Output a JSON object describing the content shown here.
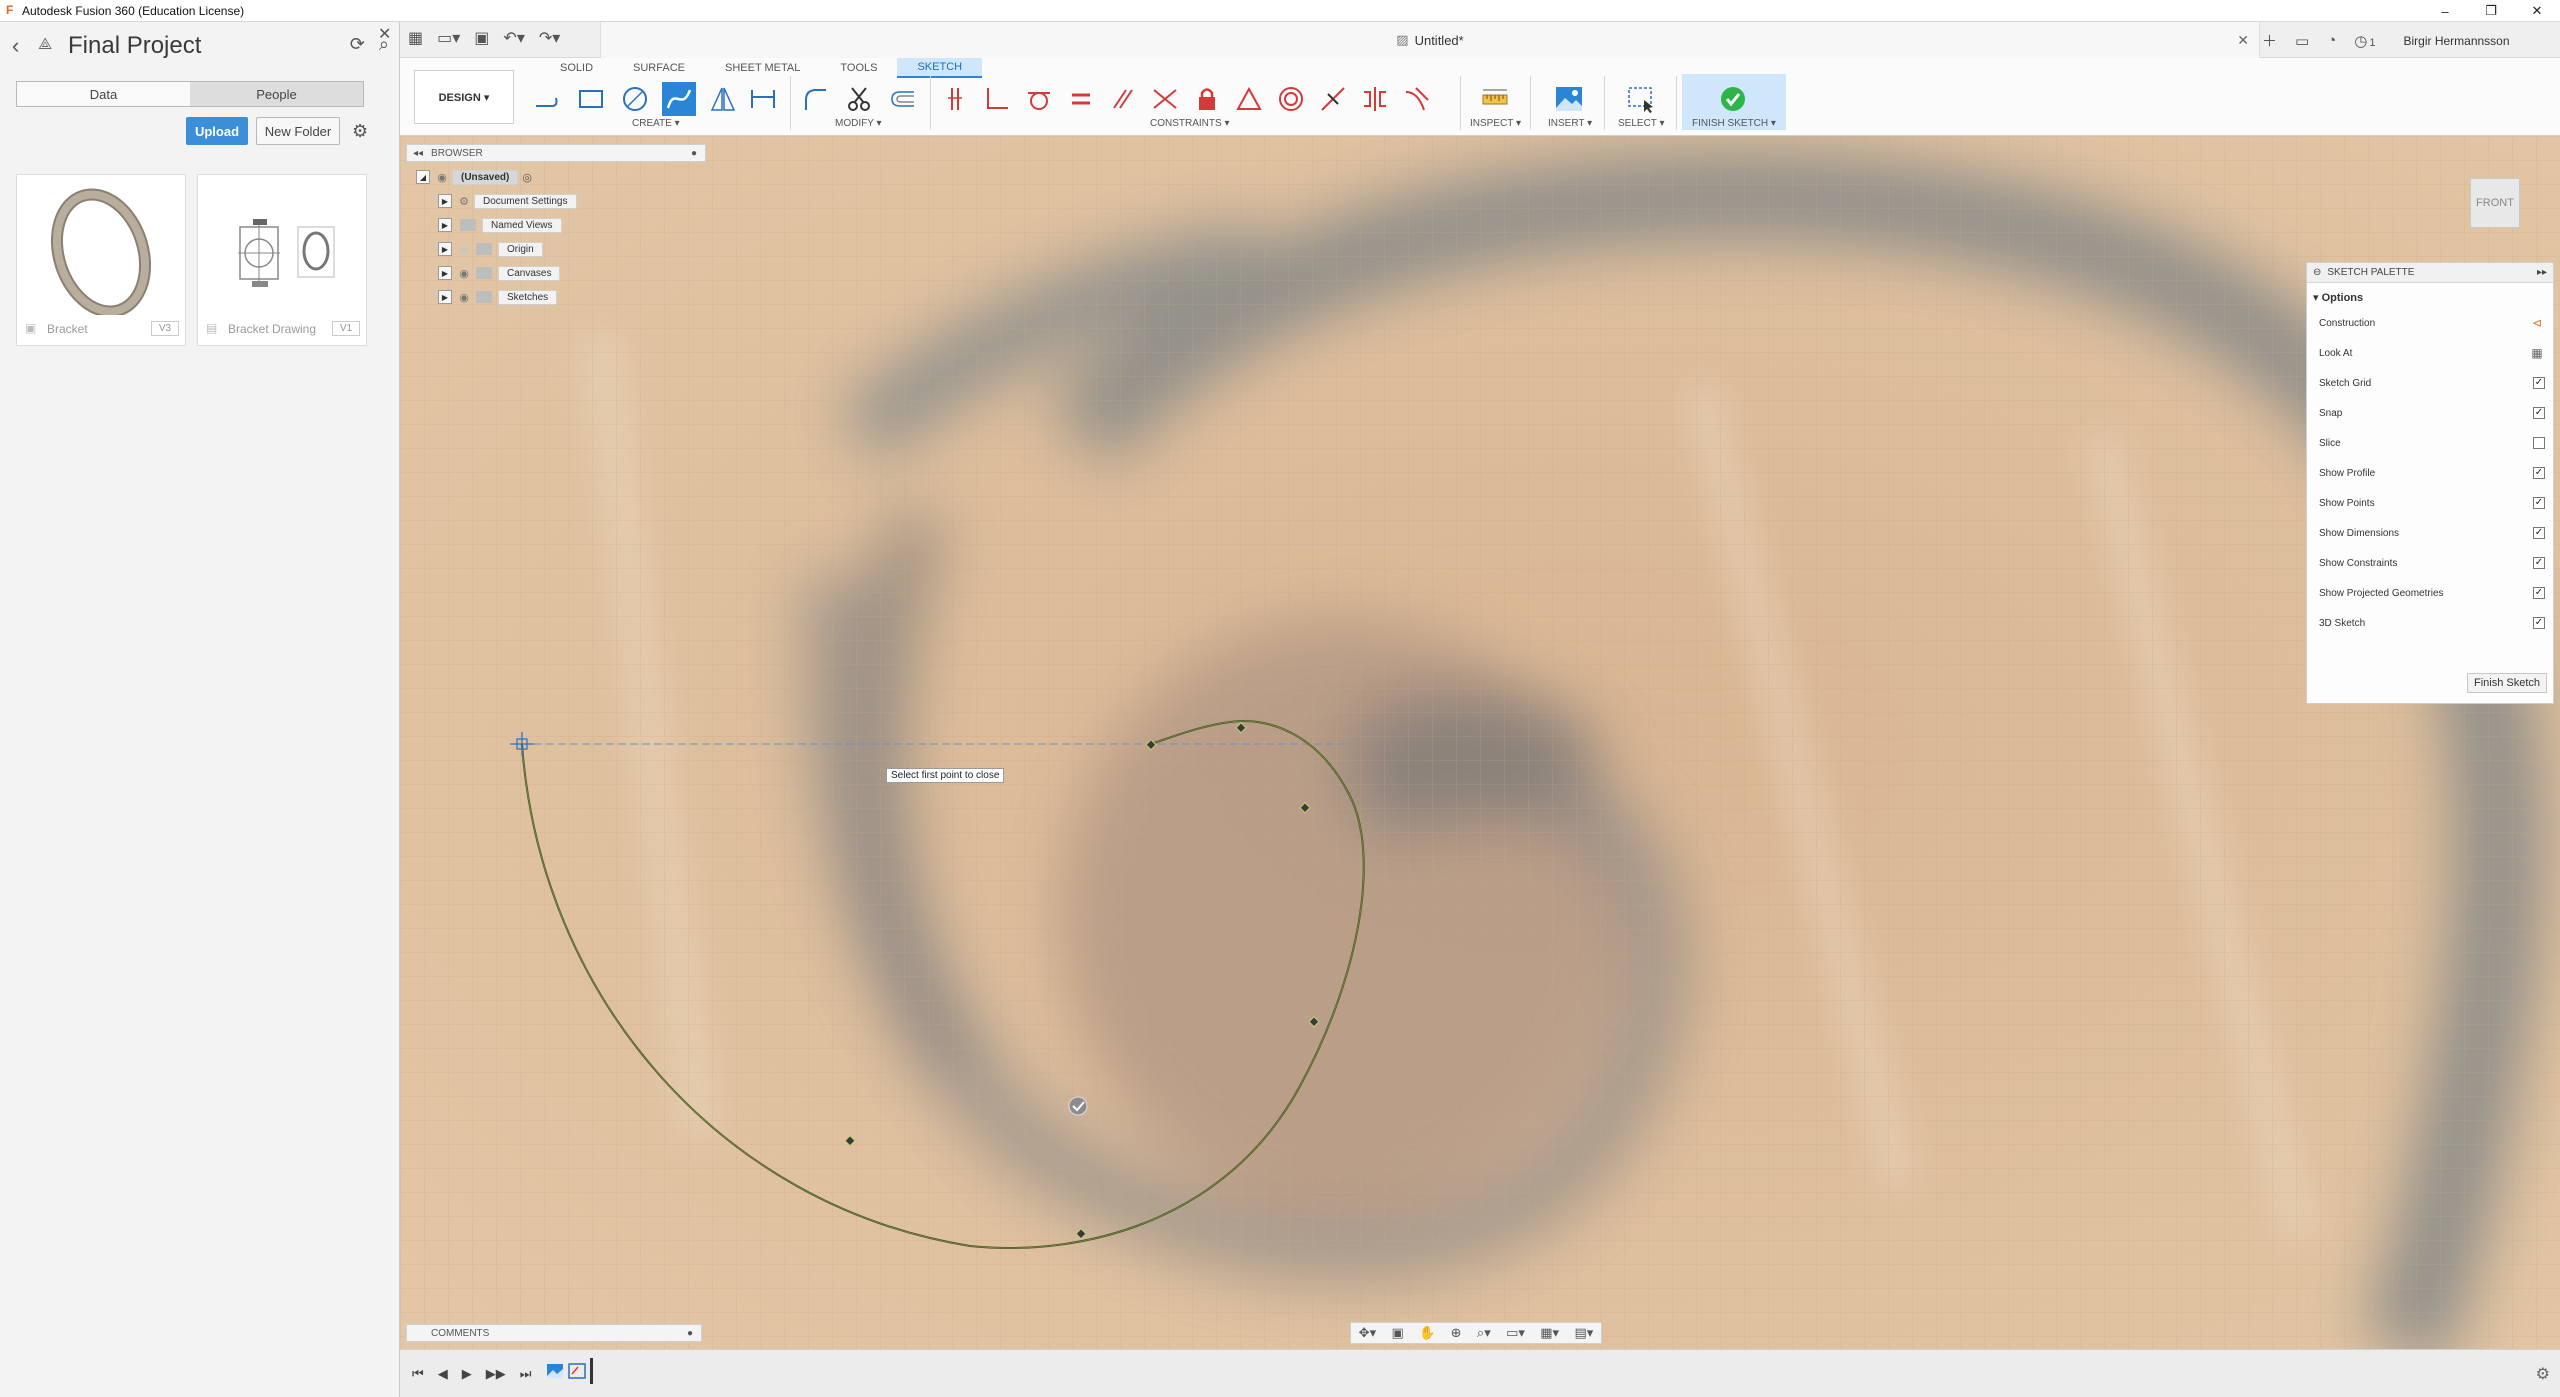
{
  "window": {
    "title": "Autodesk Fusion 360 (Education License)"
  },
  "data_panel": {
    "project_title": "Final Project",
    "tabs": [
      {
        "label": "Data"
      },
      {
        "label": "People"
      }
    ],
    "upload_label": "Upload",
    "new_folder_label": "New Folder",
    "files": [
      {
        "name": "Bracket",
        "version": "V3"
      },
      {
        "name": "Bracket Drawing",
        "version": "V1"
      }
    ]
  },
  "document": {
    "tab_title": "Untitled*",
    "user_name": "Birgir Hermannsson",
    "notification_count": "1"
  },
  "toolbar": {
    "tabs": [
      {
        "label": "SOLID"
      },
      {
        "label": "SURFACE"
      },
      {
        "label": "SHEET METAL"
      },
      {
        "label": "TOOLS"
      },
      {
        "label": "SKETCH",
        "active": true
      }
    ],
    "workspace_label": "DESIGN ▾",
    "groups": {
      "create": "CREATE ▾",
      "modify": "MODIFY ▾",
      "constraints": "CONSTRAINTS ▾",
      "inspect": "INSPECT ▾",
      "insert": "INSERT ▾",
      "select": "SELECT ▾",
      "finish_sketch": "FINISH SKETCH ▾"
    }
  },
  "browser": {
    "title": "BROWSER",
    "items": [
      {
        "label": "(Unsaved)"
      },
      {
        "label": "Document Settings"
      },
      {
        "label": "Named Views"
      },
      {
        "label": "Origin"
      },
      {
        "label": "Canvases"
      },
      {
        "label": "Sketches"
      }
    ]
  },
  "sketch_palette": {
    "title": "SKETCH PALETTE",
    "section": "Options",
    "options": [
      {
        "label": "Construction",
        "kind": "icon"
      },
      {
        "label": "Look At",
        "kind": "icon"
      },
      {
        "label": "Sketch Grid",
        "checked": true
      },
      {
        "label": "Snap",
        "checked": true
      },
      {
        "label": "Slice",
        "checked": false
      },
      {
        "label": "Show Profile",
        "checked": true
      },
      {
        "label": "Show Points",
        "checked": true
      },
      {
        "label": "Show Dimensions",
        "checked": true
      },
      {
        "label": "Show Constraints",
        "checked": true
      },
      {
        "label": "Show Projected Geometries",
        "checked": true
      },
      {
        "label": "3D Sketch",
        "checked": true
      }
    ],
    "finish_button": "Finish Sketch"
  },
  "viewport": {
    "tooltip": "Select first point to close",
    "viewcube_label": "FRONT"
  },
  "comments": {
    "label": "COMMENTS"
  },
  "colors": {
    "accent": "#2a85d6",
    "canvas": "#d9b896",
    "spline": "#6a7a3a"
  }
}
